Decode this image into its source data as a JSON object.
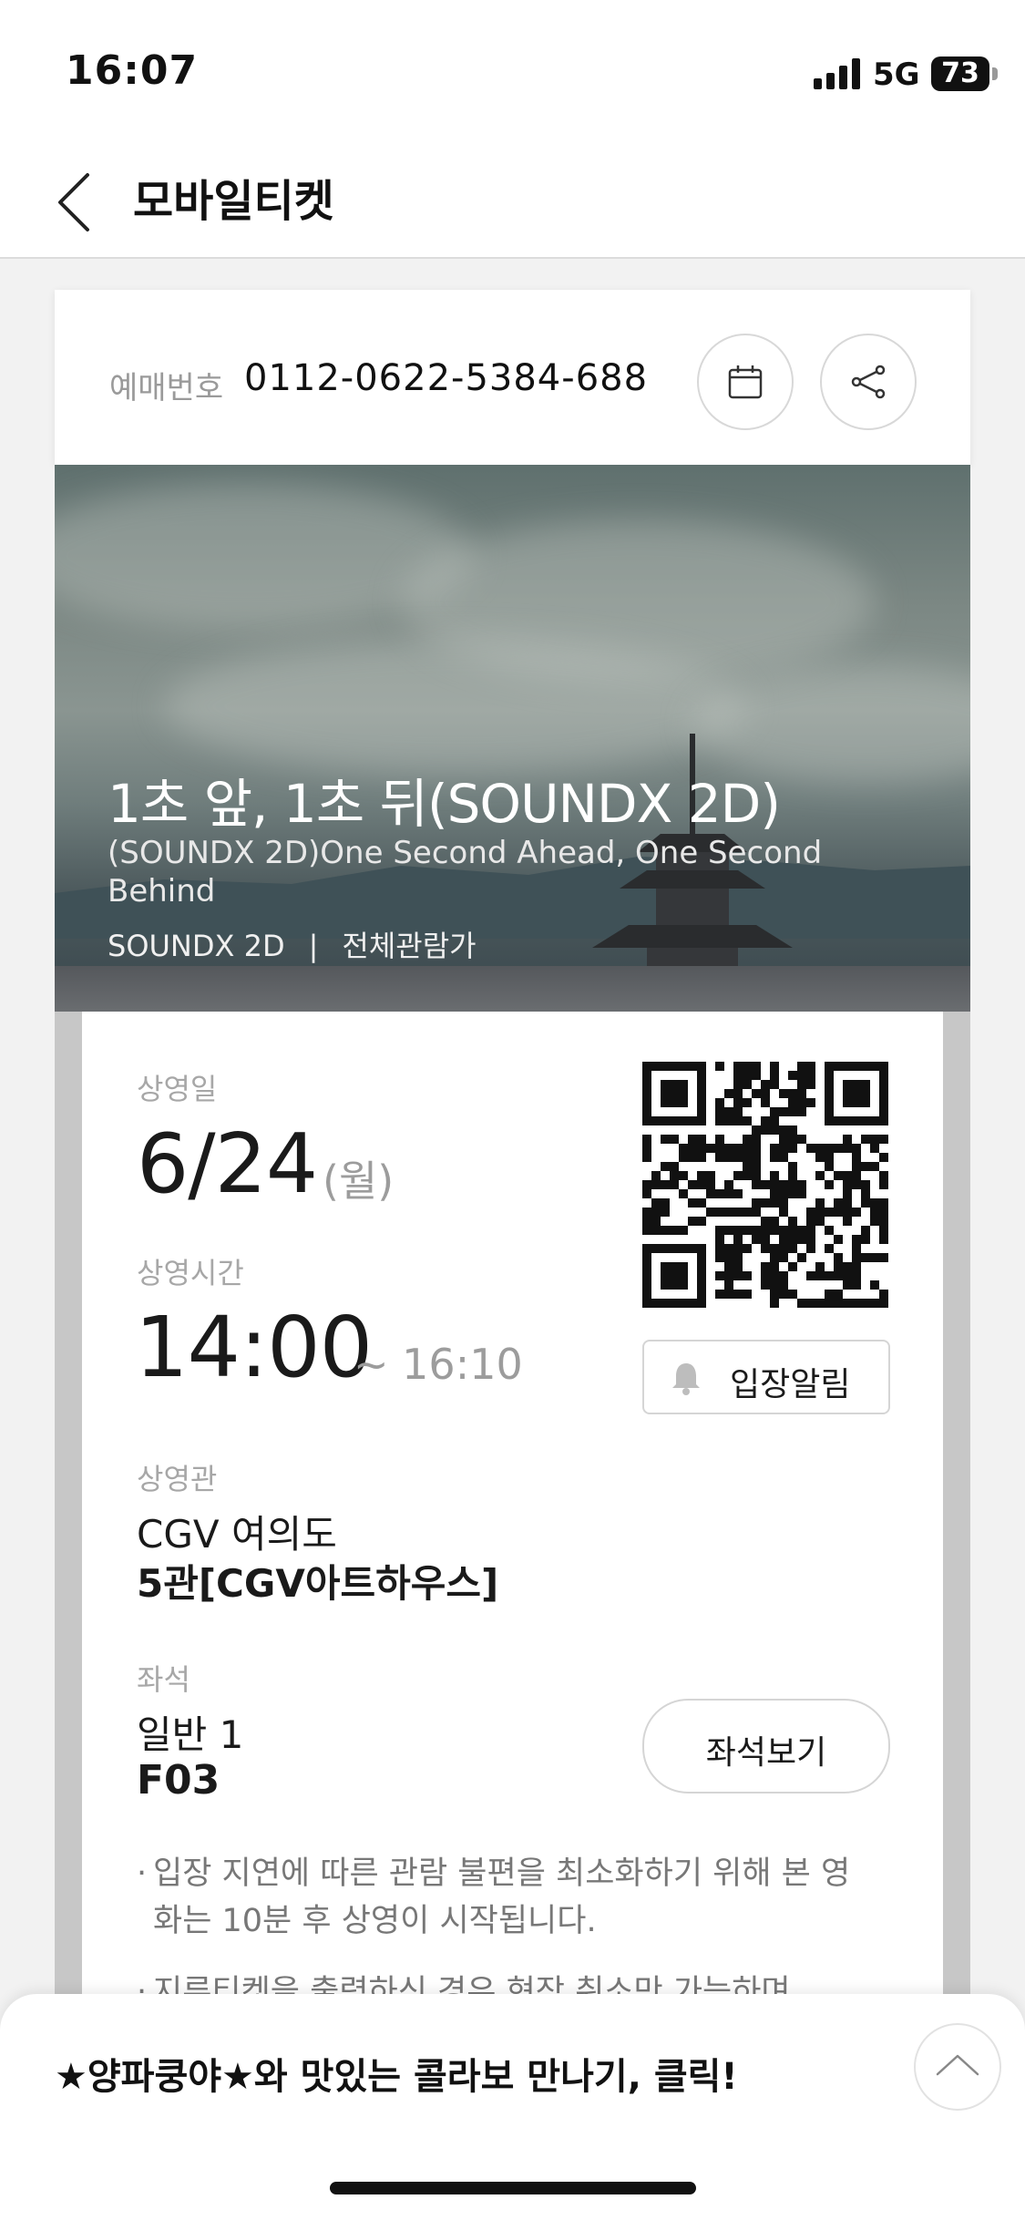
{
  "status_bar": {
    "time": "16:07",
    "network": "5G",
    "battery": "73"
  },
  "header": {
    "title": "모바일티켓"
  },
  "ticket": {
    "booking_label": "예매번호",
    "booking_number": "0112-0622-5384-688",
    "movie": {
      "title": "1초 앞, 1초 뒤(SOUNDX 2D)",
      "subtitle": "(SOUNDX 2D)One Second Ahead, One Second Behind",
      "format": "SOUNDX 2D",
      "separator": "|",
      "rating": "전체관람가"
    },
    "date_label": "상영일",
    "date": "6/24",
    "day": "(월)",
    "time_label": "상영시간",
    "start_time": "14:00",
    "end_time": "~ 16:10",
    "theater_label": "상영관",
    "theater": "CGV 여의도",
    "hall": "5관[CGV아트하우스]",
    "seat_label": "좌석",
    "seat_class": "일반 1",
    "seat_number": "F03",
    "entry_alert_label": "입장알림",
    "view_seat_label": "좌석보기",
    "notices": [
      "입장 지연에 따른 관람 불편을 최소화하기 위해 본 영화는 10분 후 상영이 시작됩니다.",
      "지류티켓을 출력하신 경우 현장 취소만 가능하며"
    ],
    "bullet": "·"
  },
  "banner": {
    "text": "★양파쿵야★와 맛있는 콜라보 만나기, 클릭!"
  },
  "icons": {
    "back": "chevron-left-icon",
    "calendar": "calendar-icon",
    "share": "share-icon",
    "bell": "bell-icon",
    "scroll_top": "chevron-up-icon"
  }
}
